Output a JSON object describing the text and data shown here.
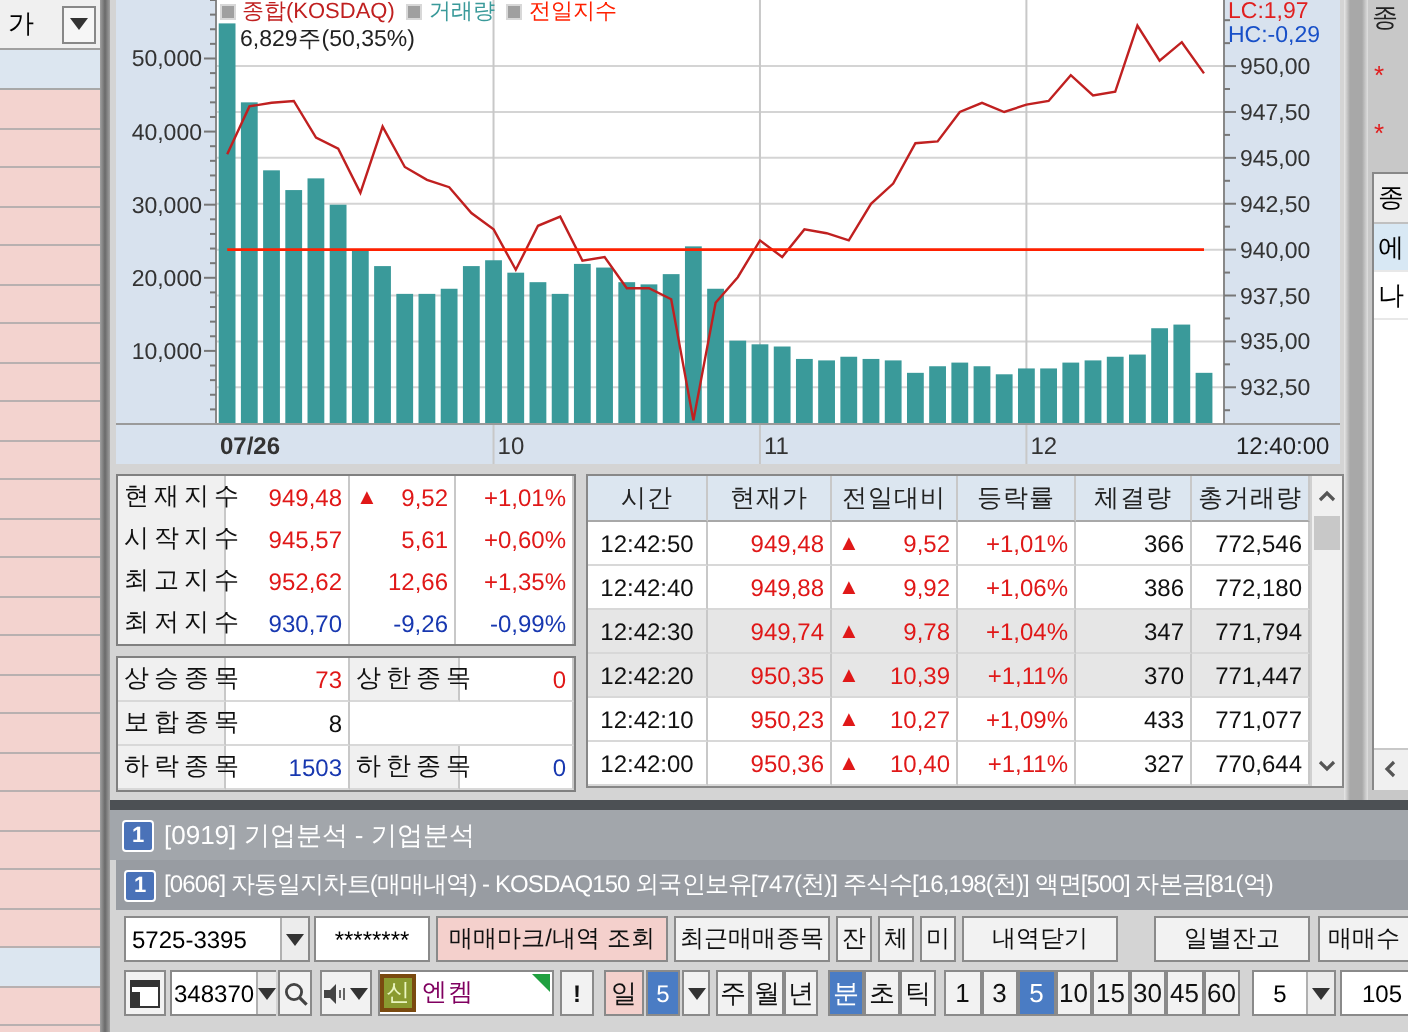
{
  "left_panel": {
    "header": "가",
    "rows": [
      {
        "selected": false
      },
      {
        "selected": false
      },
      {
        "selected": false
      },
      {
        "selected": false
      },
      {
        "selected": false
      },
      {
        "selected": false
      },
      {
        "selected": false
      },
      {
        "selected": false
      },
      {
        "selected": false
      },
      {
        "selected": false
      },
      {
        "selected": false
      },
      {
        "selected": false
      },
      {
        "selected": false
      },
      {
        "selected": false
      },
      {
        "selected": false
      },
      {
        "selected": false
      },
      {
        "selected": false
      },
      {
        "selected": false
      },
      {
        "selected": false
      },
      {
        "selected": false
      },
      {
        "selected": false
      },
      {
        "selected": false
      },
      {
        "selected": true
      },
      {
        "selected": false
      }
    ]
  },
  "chart": {
    "volume_note": "6,829주(50,35%)",
    "lc": "LC:1,97",
    "hc": "HC:-0,29",
    "time_label": "12:40:00",
    "time_axis": [
      "07/26",
      "10",
      "11",
      "12"
    ],
    "volume_pane": {
      "chart_data": {
        "type": "bar",
        "ylim": [
          0,
          58000
        ],
        "yticks": [
          {
            "value": 10000,
            "label": "10,000"
          },
          {
            "value": 20000,
            "label": "20,000"
          },
          {
            "value": 30000,
            "label": "30,000"
          },
          {
            "value": 40000,
            "label": "40,000"
          },
          {
            "value": 50000,
            "label": "50,000"
          }
        ],
        "series": [
          {
            "name": "거래량",
            "color": "#3a9a9a",
            "values": [
              54800,
              44000,
              34700,
              32000,
              33600,
              30000,
              23700,
              21600,
              17800,
              17800,
              18500,
              21600,
              22400,
              20700,
              19400,
              17800,
              21900,
              21400,
              19400,
              19100,
              20500,
              24300,
              18500,
              11400,
              10900,
              10600,
              8900,
              8700,
              9200,
              8900,
              8700,
              7000,
              7900,
              8400,
              7900,
              6800,
              7600,
              7600,
              8400,
              8700,
              9200,
              9500,
              13100,
              13600,
              7000
            ]
          }
        ]
      }
    },
    "index_pane": {
      "chart_data": {
        "type": "line",
        "ylim": [
          930.5,
          953.6
        ],
        "yticks": [
          {
            "value": 932.5,
            "label": "932,50"
          },
          {
            "value": 935,
            "label": "935,00"
          },
          {
            "value": 937.5,
            "label": "937,50"
          },
          {
            "value": 940,
            "label": "940,00"
          },
          {
            "value": 942.5,
            "label": "942,50"
          },
          {
            "value": 945,
            "label": "945,00"
          },
          {
            "value": 947.5,
            "label": "947,50"
          },
          {
            "value": 950,
            "label": "950,00"
          }
        ],
        "series": [
          {
            "name": "종합(KOSDAQ)",
            "color": "#c02020",
            "values": [
              945.2,
              947.8,
              948.0,
              948.1,
              946.1,
              945.5,
              943.1,
              946.7,
              944.5,
              943.8,
              943.4,
              942.0,
              941.1,
              938.9,
              941.3,
              941.8,
              939.4,
              939.6,
              937.9,
              937.9,
              937.3,
              930.7,
              937.1,
              938.5,
              940.5,
              939.6,
              941.1,
              940.9,
              940.5,
              942.5,
              943.6,
              945.8,
              945.9,
              947.5,
              948.0,
              947.5,
              947.9,
              948.1,
              949.5,
              948.4,
              948.6,
              952.2,
              950.3,
              951.3,
              949.6
            ]
          },
          {
            "name": "전일지수",
            "color": "#ff2000",
            "values": [
              940.0,
              940.0,
              940.0,
              940.0,
              940.0,
              940.0,
              940.0,
              940.0,
              940.0,
              940.0,
              940.0,
              940.0,
              940.0,
              940.0,
              940.0,
              940.0,
              940.0,
              940.0,
              940.0,
              940.0,
              940.0,
              940.0,
              940.0,
              940.0,
              940.0,
              940.0,
              940.0,
              940.0,
              940.0,
              940.0,
              940.0,
              940.0,
              940.0,
              940.0,
              940.0,
              940.0,
              940.0,
              940.0,
              940.0,
              940.0,
              940.0,
              940.0,
              940.0,
              940.0,
              940.0
            ]
          }
        ]
      }
    }
  },
  "index_summary": {
    "rows": [
      {
        "label": "현재지수",
        "value": "949,48",
        "sign": "▲",
        "change": "9,52",
        "rate": "+1,01%",
        "color": "#e01818"
      },
      {
        "label": "시작지수",
        "value": "945,57",
        "change": "5,61",
        "rate": "+0,60%",
        "color": "#e01818"
      },
      {
        "label": "최고지수",
        "value": "952,62",
        "change": "12,66",
        "rate": "+1,35%",
        "color": "#e01818"
      },
      {
        "label": "최저지수",
        "value": "930,70",
        "change": "-9,26",
        "rate": "-0,99%",
        "color": "#1838b0"
      }
    ]
  },
  "breadth": {
    "rows": [
      [
        {
          "label": "상승종목",
          "value": "73",
          "color": "#e01818"
        },
        {
          "label": "상한종목",
          "value": "0",
          "color": "#e01818"
        }
      ],
      [
        {
          "label": "보합종목",
          "value": "8",
          "color": "#111111"
        }
      ],
      [
        {
          "label": "하락종목",
          "value": "1503",
          "color": "#1838b0"
        },
        {
          "label": "하한종목",
          "value": "0",
          "color": "#1838b0"
        }
      ]
    ]
  },
  "ticks": {
    "columns": [
      "시간",
      "현재가",
      "전일대비",
      "등락률",
      "체결량",
      "총거래량"
    ],
    "rows": [
      {
        "time": "12:42:50",
        "price": "949,48",
        "sign": "▲",
        "change": "9,52",
        "rate": "+1,01%",
        "volume": "366",
        "total": "772,546",
        "color": "#e01818",
        "shaded": false
      },
      {
        "time": "12:42:40",
        "price": "949,88",
        "sign": "▲",
        "change": "9,92",
        "rate": "+1,06%",
        "volume": "386",
        "total": "772,180",
        "color": "#e01818",
        "shaded": false
      },
      {
        "time": "12:42:30",
        "price": "949,74",
        "sign": "▲",
        "change": "9,78",
        "rate": "+1,04%",
        "volume": "347",
        "total": "771,794",
        "color": "#e01818",
        "shaded": true
      },
      {
        "time": "12:42:20",
        "price": "950,35",
        "sign": "▲",
        "change": "10,39",
        "rate": "+1,11%",
        "volume": "370",
        "total": "771,447",
        "color": "#e01818",
        "shaded": true
      },
      {
        "time": "12:42:10",
        "price": "950,23",
        "sign": "▲",
        "change": "10,27",
        "rate": "+1,09%",
        "volume": "433",
        "total": "771,077",
        "color": "#e01818",
        "shaded": false
      },
      {
        "time": "12:42:00",
        "price": "950,36",
        "sign": "▲",
        "change": "10,40",
        "rate": "+1,11%",
        "volume": "327",
        "total": "770,644",
        "color": "#e01818",
        "shaded": false
      }
    ]
  },
  "side_panel": {
    "title": "종",
    "marks": [
      "*",
      "*"
    ],
    "list_header": "종",
    "items": [
      {
        "label": "에",
        "selected": true
      },
      {
        "label": "나",
        "selected": false
      }
    ]
  },
  "windows": [
    {
      "badge": "1",
      "title": "[0919] 기업분석 - 기업분석"
    },
    {
      "badge": "1",
      "title": "[0606] 자동일지차트(매매내역) - KOSDAQ150 외국인보유[747(천)] 주식수[16,198(천)] 액면[500] 자본금[81(억)"
    }
  ],
  "account_toolbar": {
    "account": "5725-3395",
    "password": "********",
    "buttons": [
      {
        "label": "매매마크/내역 조회",
        "kind": "accent"
      },
      {
        "label": "최근매매종목",
        "kind": "plain"
      },
      {
        "label": "잔",
        "kind": "small"
      },
      {
        "label": "체",
        "kind": "small"
      },
      {
        "label": "미",
        "kind": "small"
      },
      {
        "label": "내역닫기",
        "kind": "plain"
      }
    ],
    "right_buttons": [
      {
        "label": "일별잔고"
      },
      {
        "label": "매매수"
      }
    ]
  },
  "chart_toolbar": {
    "code": "348370",
    "stock": {
      "badge": "신",
      "name": "엔켐"
    },
    "alert": "!",
    "day_button": "일",
    "day_count": "5",
    "period_units": [
      {
        "label": "주",
        "selected": false
      },
      {
        "label": "월",
        "selected": false
      },
      {
        "label": "년",
        "selected": false
      }
    ],
    "time_units": [
      {
        "label": "분",
        "selected": true
      },
      {
        "label": "초",
        "selected": false
      },
      {
        "label": "틱",
        "selected": false
      }
    ],
    "intervals": [
      {
        "label": "1",
        "selected": false
      },
      {
        "label": "3",
        "selected": false
      },
      {
        "label": "5",
        "selected": true
      },
      {
        "label": "10",
        "selected": false
      },
      {
        "label": "15",
        "selected": false
      },
      {
        "label": "30",
        "selected": false
      },
      {
        "label": "45",
        "selected": false
      },
      {
        "label": "60",
        "selected": false
      }
    ],
    "count": "5",
    "bars": "105"
  }
}
